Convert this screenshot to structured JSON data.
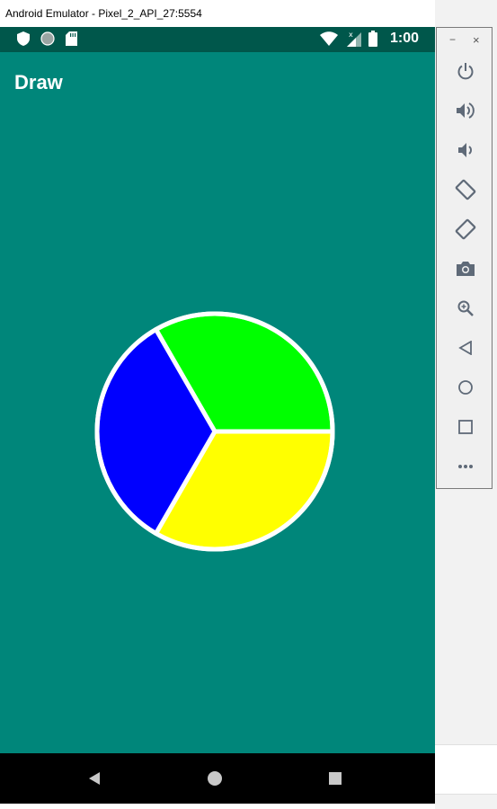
{
  "window": {
    "title": "Android Emulator - Pixel_2_API_27:5554"
  },
  "status_bar": {
    "time": "1:00"
  },
  "app": {
    "title": "Draw"
  },
  "toolbar": {
    "minimize": "−",
    "close": "×",
    "buttons": [
      "power-icon",
      "volume-up-icon",
      "volume-down-icon",
      "rotate-left-icon",
      "rotate-right-icon",
      "camera-icon",
      "zoom-icon",
      "back-icon",
      "home-icon",
      "overview-icon",
      "more-icon"
    ]
  },
  "colors": {
    "status_bar": "#00574b",
    "app_bar": "#00867a",
    "background": "#00867a",
    "pie_stroke": "#ffffff"
  },
  "chart_data": {
    "type": "pie",
    "values": [
      1,
      1,
      1
    ],
    "colors": [
      "#00ff00",
      "#ffff00",
      "#0000ff"
    ]
  }
}
